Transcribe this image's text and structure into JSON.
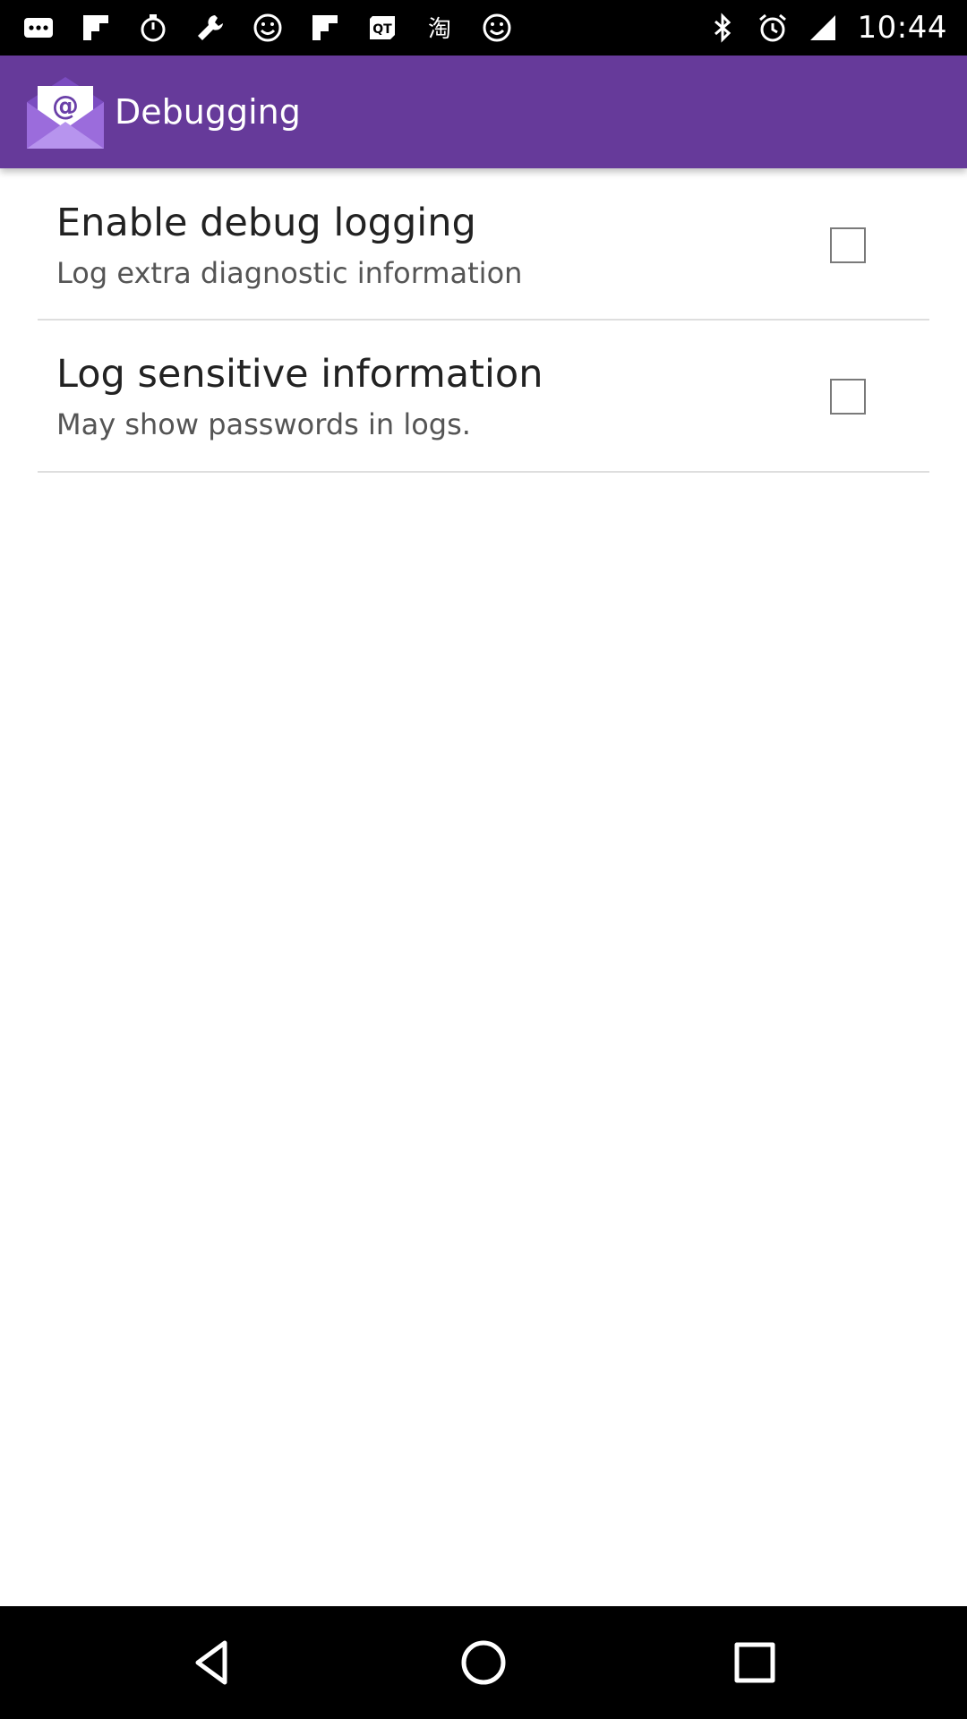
{
  "status_bar": {
    "left_icons": [
      "more-notifications-icon",
      "flipboard-icon",
      "stopwatch-icon",
      "wrench-icon",
      "smiley-icon",
      "flipboard-icon",
      "qt-icon",
      "taobao-icon",
      "smiley-icon"
    ],
    "right_icons": [
      "bluetooth-icon",
      "alarm-icon",
      "signal-icon"
    ],
    "time": "10:44"
  },
  "app_bar": {
    "title": "Debugging",
    "logo_icon": "email-app-icon",
    "color": "#663a9a"
  },
  "preferences": [
    {
      "title": "Enable debug logging",
      "summary": "Log extra diagnostic information",
      "checked": false
    },
    {
      "title": "Log sensitive information",
      "summary": "May show passwords in logs.",
      "checked": false
    }
  ],
  "nav_bar": {
    "buttons": [
      "back-icon",
      "home-icon",
      "recents-icon"
    ]
  }
}
